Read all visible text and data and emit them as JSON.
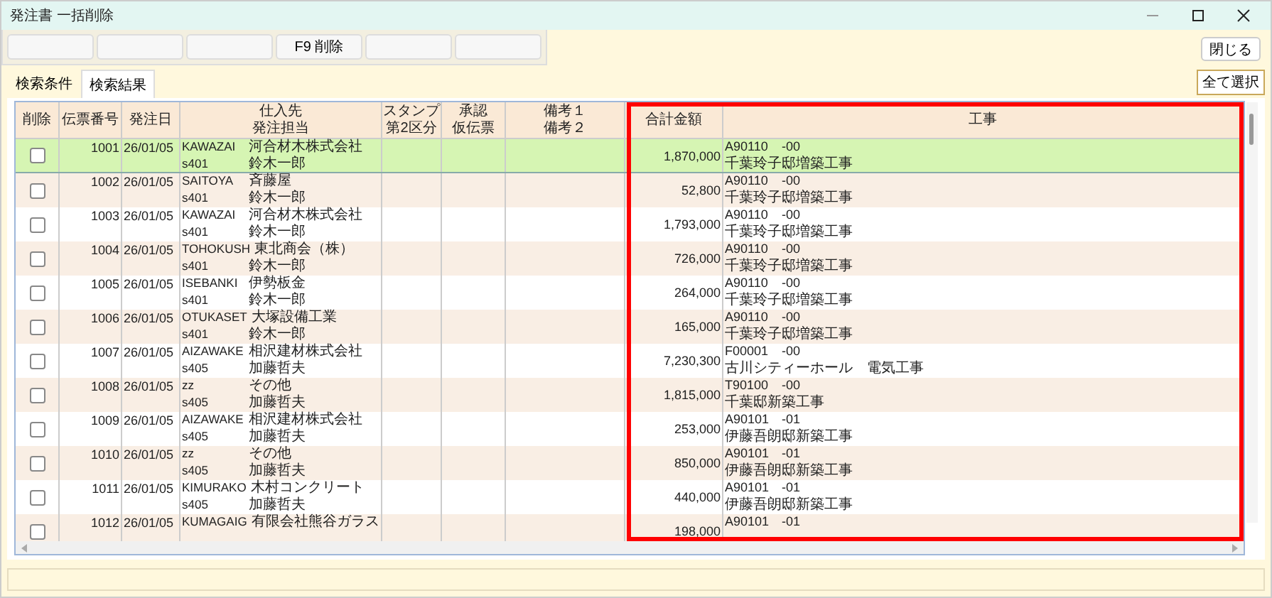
{
  "window": {
    "title": "発注書 一括削除"
  },
  "toolbar": {
    "buttons": [
      {
        "kind": "blank"
      },
      {
        "kind": "blank"
      },
      {
        "kind": "blank"
      },
      {
        "kind": "key",
        "label": "F9 削除"
      },
      {
        "kind": "blank"
      },
      {
        "kind": "blank"
      }
    ],
    "close": "閉じる"
  },
  "tabs": [
    {
      "label": "検索条件",
      "selected": false
    },
    {
      "label": "検索結果",
      "selected": true
    }
  ],
  "select_all": "全て選択",
  "table": {
    "columns": [
      [
        "削除"
      ],
      [
        "伝票番号"
      ],
      [
        "発注日"
      ],
      [
        "仕入先",
        "発注担当"
      ],
      [
        "スタンプ",
        "第2区分"
      ],
      [
        "承認",
        "仮伝票"
      ],
      [
        "備考１",
        "備考２"
      ],
      [
        "合計金額"
      ],
      [
        "工事"
      ]
    ],
    "rows": [
      {
        "checked": false,
        "selected": true,
        "no": "1001",
        "date": "26/01/05",
        "supplier_code": "KAWAZAI",
        "supplier": "河合材木株式会社",
        "staff_code": "s401",
        "staff": "鈴木一郎",
        "total": "1,870,000",
        "project_code": "A90110",
        "project_branch": "-00",
        "project": "千葉玲子邸増築工事"
      },
      {
        "checked": false,
        "selected": false,
        "no": "1002",
        "date": "26/01/05",
        "supplier_code": "SAITOYA",
        "supplier": "斉藤屋",
        "staff_code": "s401",
        "staff": "鈴木一郎",
        "total": "52,800",
        "project_code": "A90110",
        "project_branch": "-00",
        "project": "千葉玲子邸増築工事"
      },
      {
        "checked": false,
        "selected": false,
        "no": "1003",
        "date": "26/01/05",
        "supplier_code": "KAWAZAI",
        "supplier": "河合材木株式会社",
        "staff_code": "s401",
        "staff": "鈴木一郎",
        "total": "1,793,000",
        "project_code": "A90110",
        "project_branch": "-00",
        "project": "千葉玲子邸増築工事"
      },
      {
        "checked": false,
        "selected": false,
        "no": "1004",
        "date": "26/01/05",
        "supplier_code": "TOHOKUSH",
        "supplier": "東北商会（株）",
        "staff_code": "s401",
        "staff": "鈴木一郎",
        "total": "726,000",
        "project_code": "A90110",
        "project_branch": "-00",
        "project": "千葉玲子邸増築工事"
      },
      {
        "checked": false,
        "selected": false,
        "no": "1005",
        "date": "26/01/05",
        "supplier_code": "ISEBANKI",
        "supplier": "伊勢板金",
        "staff_code": "s401",
        "staff": "鈴木一郎",
        "total": "264,000",
        "project_code": "A90110",
        "project_branch": "-00",
        "project": "千葉玲子邸増築工事"
      },
      {
        "checked": false,
        "selected": false,
        "no": "1006",
        "date": "26/01/05",
        "supplier_code": "OTUKASET",
        "supplier": "大塚設備工業",
        "staff_code": "s401",
        "staff": "鈴木一郎",
        "total": "165,000",
        "project_code": "A90110",
        "project_branch": "-00",
        "project": "千葉玲子邸増築工事"
      },
      {
        "checked": false,
        "selected": false,
        "no": "1007",
        "date": "26/01/05",
        "supplier_code": "AIZAWAKE",
        "supplier": "相沢建材株式会社",
        "staff_code": "s405",
        "staff": "加藤哲夫",
        "total": "7,230,300",
        "project_code": "F00001",
        "project_branch": "-00",
        "project": "古川シティーホール　電気工事"
      },
      {
        "checked": false,
        "selected": false,
        "no": "1008",
        "date": "26/01/05",
        "supplier_code": "zz",
        "supplier": "その他",
        "staff_code": "s405",
        "staff": "加藤哲夫",
        "total": "1,815,000",
        "project_code": "T90100",
        "project_branch": "-00",
        "project": "千葉邸新築工事"
      },
      {
        "checked": false,
        "selected": false,
        "no": "1009",
        "date": "26/01/05",
        "supplier_code": "AIZAWAKE",
        "supplier": "相沢建材株式会社",
        "staff_code": "s405",
        "staff": "加藤哲夫",
        "total": "253,000",
        "project_code": "A90101",
        "project_branch": "-01",
        "project": "伊藤吾朗邸新築工事"
      },
      {
        "checked": false,
        "selected": false,
        "no": "1010",
        "date": "26/01/05",
        "supplier_code": "zz",
        "supplier": "その他",
        "staff_code": "s405",
        "staff": "加藤哲夫",
        "total": "850,000",
        "project_code": "A90101",
        "project_branch": "-01",
        "project": "伊藤吾朗邸新築工事"
      },
      {
        "checked": false,
        "selected": false,
        "no": "1011",
        "date": "26/01/05",
        "supplier_code": "KIMURAKO",
        "supplier": "木村コンクリート",
        "staff_code": "s405",
        "staff": "加藤哲夫",
        "total": "440,000",
        "project_code": "A90101",
        "project_branch": "-01",
        "project": "伊藤吾朗邸新築工事"
      },
      {
        "checked": false,
        "selected": false,
        "no": "1012",
        "date": "26/01/05",
        "supplier_code": "KUMAGAIG",
        "supplier": "有限会社熊谷ガラス",
        "total": "198,000",
        "project_code": "A90101",
        "project_branch": "-01"
      }
    ]
  },
  "annotation": {
    "kind": "frame",
    "color": "#ff0000"
  }
}
